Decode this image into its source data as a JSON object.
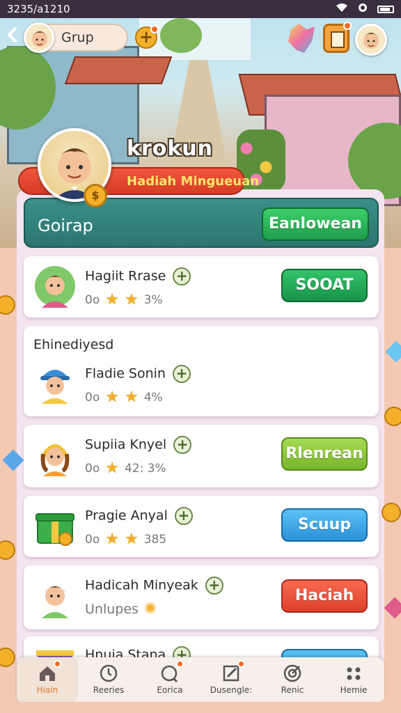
{
  "status_bar": {
    "time": "3235/a1210"
  },
  "header": {
    "back_icon": "chevron-left-icon",
    "group_label": "Grup",
    "plus_icon": "plus-icon"
  },
  "profile": {
    "name": "krokun",
    "subtitle": "Hadiah Mingueuan"
  },
  "group_bar": {
    "label": "Goirap",
    "join_label": "Eanlowean"
  },
  "section_title": "Ehinediyesd",
  "members": [
    {
      "name": "Hagiit Rrase",
      "prefix": "0o",
      "score": "3%",
      "button": "SOOAT",
      "color": "green"
    },
    {
      "name": "Fladie Sonin",
      "prefix": "0o",
      "score": "4%",
      "button": "",
      "color": ""
    },
    {
      "name": "Supiia Knyel",
      "prefix": "0o",
      "score": "42: 3%",
      "button": "Rlenrean",
      "color": "lime"
    },
    {
      "name": "Pragie Anyal",
      "prefix": "0o",
      "score": "385",
      "button": "Scuup",
      "color": "blue"
    },
    {
      "name": "Hadicah Minyeak",
      "prefix": "Unlupes",
      "score": "",
      "button": "Haciah",
      "color": "red"
    },
    {
      "name": "Hnuia Stana",
      "prefix": "",
      "score": "",
      "button": "",
      "color": "blue"
    }
  ],
  "tabs": [
    {
      "label": "Hiain",
      "icon": "home-icon",
      "active": true
    },
    {
      "label": "Reeries",
      "icon": "clock-icon",
      "active": false
    },
    {
      "label": "Eorica",
      "icon": "chat-icon",
      "active": false
    },
    {
      "label": "Dusengle:",
      "icon": "edit-icon",
      "active": false
    },
    {
      "label": "Renic",
      "icon": "target-icon",
      "active": false
    },
    {
      "label": "Hemie",
      "icon": "dots-icon",
      "active": false
    }
  ],
  "colors": {
    "accent_teal": "#2b7570",
    "button_green": "#1e9e4a",
    "banner_red": "#d63b25",
    "notification": "#f26b2a"
  }
}
